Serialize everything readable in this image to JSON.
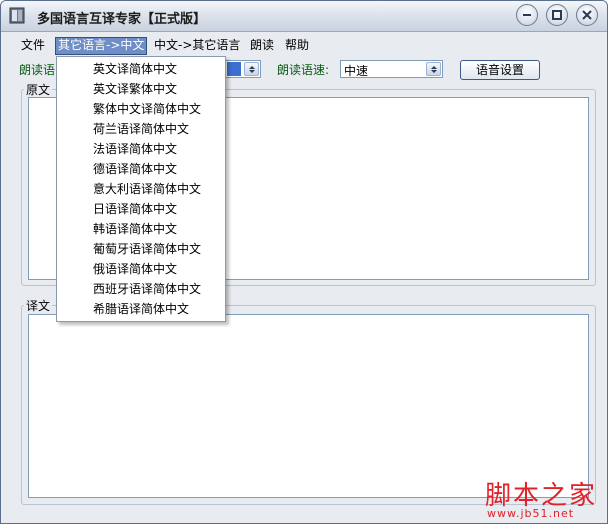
{
  "window": {
    "title": "多国语言互译专家【正式版】"
  },
  "menubar": {
    "items": [
      {
        "label": "文件"
      },
      {
        "label": "其它语言->中文"
      },
      {
        "label": "中文->其它语言"
      },
      {
        "label": "朗读"
      },
      {
        "label": "帮助"
      }
    ]
  },
  "toolbar": {
    "read_language_label": "朗读语",
    "read_speed_label": "朗读语速:",
    "read_speed_value": "中速",
    "voice_settings_button": "语音设置"
  },
  "source_group": {
    "label": "原文"
  },
  "target_group": {
    "label": "译文"
  },
  "dropdown": {
    "items": [
      "英文译简体中文",
      "英文译繁体中文",
      "繁体中文译简体中文",
      "荷兰语译简体中文",
      "法语译简体中文",
      "德语译简体中文",
      "意大利语译简体中文",
      "日语译简体中文",
      "韩语译简体中文",
      "葡萄牙语译简体中文",
      "俄语译简体中文",
      "西班牙语译简体中文",
      "希腊语译简体中文"
    ]
  },
  "watermark": {
    "main": "脚本之家",
    "sub": "www.jb51.net"
  },
  "colors": {
    "menu_active": "#6f8ec6",
    "label_green": "#0a5b14",
    "watermark_red": "#e0222a"
  }
}
